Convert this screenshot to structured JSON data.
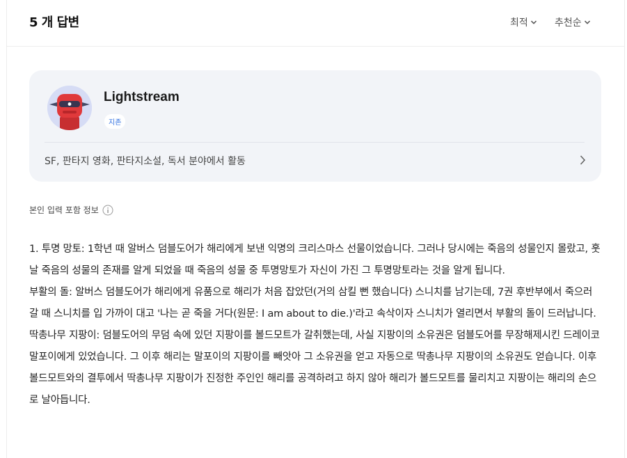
{
  "header": {
    "answer_count": "5 개 답변",
    "sort_best": "최적",
    "sort_recommend": "추천순"
  },
  "profile": {
    "name": "Lightstream",
    "badge": "지존",
    "description": "SF, 판타지 영화, 판타지소설, 독서 분야에서 활동"
  },
  "notice": "본인 입력 포함 정보",
  "answer": {
    "paragraphs": [
      "1. 투명 망토: 1학년 때 알버스 덤블도어가 해리에게 보낸 익명의 크리스마스 선물이었습니다. 그러나 당시에는 죽음의 성물인지 몰랐고, 훗날 죽음의 성물의 존재를 알게 되었을 때 죽음의 성물 중 투명망토가 자신이 가진 그 투명망토라는 것을 알게 됩니다.",
      "부활의 돌: 알버스 덤블도어가 해리에게 유품으로 해리가 처음 잡았던(거의 삼킬 뻔 했습니다) 스니치를 남기는데, 7권 후반부에서 죽으러 갈 때 스니치를 입 가까이 대고 '나는 곧 죽을 거다(원문: I am about to die.)'라고 속삭이자 스니치가 열리면서 부활의 돌이 드러납니다.",
      "딱총나무 지팡이: 덤블도어의 무덤 속에 있던 지팡이를 볼드모트가 갈취했는데, 사실 지팡이의 소유권은 덤블도어를 무장해제시킨 드레이코 말포이에게 있었습니다. 그 이후 해리는 말포이의 지팡이를 빼앗아 그 소유권을 얻고 자동으로 딱총나무 지팡이의 소유권도 얻습니다. 이후 볼드모트와의 결투에서 딱총나무 지팡이가 진정한 주인인 해리를 공격하려고 하지 않아 해리가 볼드모트를 물리치고 지팡이는 해리의 손으로 날아듭니다."
    ]
  },
  "icons": {
    "chevron_down": "chevron-down-icon",
    "chevron_right": "chevron-right-icon",
    "info": "info-icon",
    "avatar": "robot-avatar"
  },
  "colors": {
    "card_bg": "#f2f4f8",
    "badge_text": "#2f6fe0",
    "avatar_bg": "#d6dcf5",
    "robot_red": "#e0393b"
  }
}
